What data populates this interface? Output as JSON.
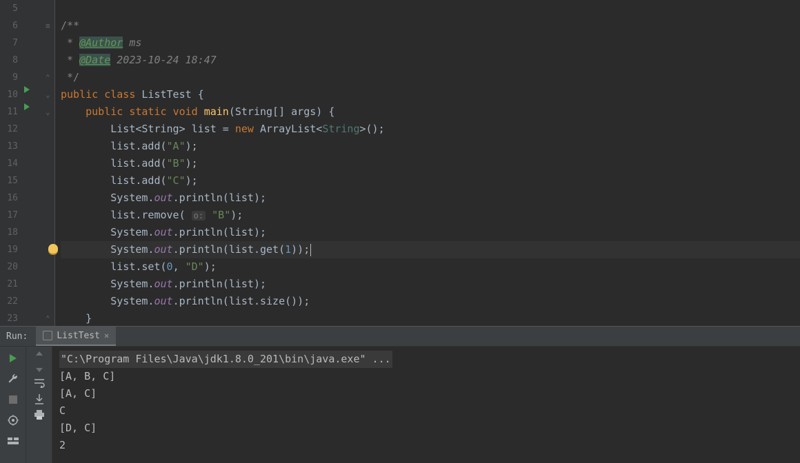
{
  "editor": {
    "lines": [
      {
        "n": 5,
        "tokens": []
      },
      {
        "n": 6,
        "tokens": [
          {
            "t": "/**",
            "cls": "comment"
          }
        ]
      },
      {
        "n": 7,
        "tokens": [
          {
            "t": " * ",
            "cls": "comment"
          },
          {
            "t": "@Author",
            "cls": "doc-tag"
          },
          {
            "t": " ms",
            "cls": "comment italic"
          }
        ]
      },
      {
        "n": 8,
        "tokens": [
          {
            "t": " * ",
            "cls": "comment"
          },
          {
            "t": "@Date",
            "cls": "doc-tag"
          },
          {
            "t": " 2023-10-24 18:47",
            "cls": "comment italic"
          }
        ]
      },
      {
        "n": 9,
        "tokens": [
          {
            "t": " */",
            "cls": "comment"
          }
        ]
      },
      {
        "n": 10,
        "run": true,
        "tokens": [
          {
            "t": "public ",
            "cls": "kw"
          },
          {
            "t": "class ",
            "cls": "kw"
          },
          {
            "t": "ListTest ",
            "cls": ""
          },
          {
            "t": "{",
            "cls": ""
          }
        ]
      },
      {
        "n": 11,
        "run": true,
        "tokens": [
          {
            "t": "    ",
            "cls": ""
          },
          {
            "t": "public ",
            "cls": "kw"
          },
          {
            "t": "static ",
            "cls": "kw"
          },
          {
            "t": "void ",
            "cls": "kw"
          },
          {
            "t": "main",
            "cls": "fn"
          },
          {
            "t": "(String[] args) {",
            "cls": ""
          }
        ]
      },
      {
        "n": 12,
        "tokens": [
          {
            "t": "        List<String> list = ",
            "cls": ""
          },
          {
            "t": "new ",
            "cls": "kw"
          },
          {
            "t": "ArrayList<",
            "cls": ""
          },
          {
            "t": "String",
            "cls": "generic-dim"
          },
          {
            "t": ">();",
            "cls": ""
          }
        ]
      },
      {
        "n": 13,
        "tokens": [
          {
            "t": "        list.add(",
            "cls": ""
          },
          {
            "t": "\"A\"",
            "cls": "str"
          },
          {
            "t": ");",
            "cls": ""
          }
        ]
      },
      {
        "n": 14,
        "tokens": [
          {
            "t": "        list.add(",
            "cls": ""
          },
          {
            "t": "\"B\"",
            "cls": "str"
          },
          {
            "t": ");",
            "cls": ""
          }
        ]
      },
      {
        "n": 15,
        "tokens": [
          {
            "t": "        list.add(",
            "cls": ""
          },
          {
            "t": "\"C\"",
            "cls": "str"
          },
          {
            "t": ");",
            "cls": ""
          }
        ]
      },
      {
        "n": 16,
        "tokens": [
          {
            "t": "        System.",
            "cls": ""
          },
          {
            "t": "out",
            "cls": "static-f"
          },
          {
            "t": ".println(list);",
            "cls": ""
          }
        ]
      },
      {
        "n": 17,
        "tokens": [
          {
            "t": "        list.remove( ",
            "cls": ""
          },
          {
            "t": "o:",
            "cls": "param-hint"
          },
          {
            "t": " ",
            "cls": ""
          },
          {
            "t": "\"B\"",
            "cls": "str"
          },
          {
            "t": ");",
            "cls": ""
          }
        ]
      },
      {
        "n": 18,
        "tokens": [
          {
            "t": "        System.",
            "cls": ""
          },
          {
            "t": "out",
            "cls": "static-f"
          },
          {
            "t": ".println(list);",
            "cls": ""
          }
        ]
      },
      {
        "n": 19,
        "bulb": true,
        "hl": true,
        "tokens": [
          {
            "t": "        System.",
            "cls": ""
          },
          {
            "t": "out",
            "cls": "static-f"
          },
          {
            "t": ".println(list.get(",
            "cls": ""
          },
          {
            "t": "1",
            "cls": "num"
          },
          {
            "t": "));",
            "cls": ""
          }
        ],
        "caret": true
      },
      {
        "n": 20,
        "tokens": [
          {
            "t": "        list.set(",
            "cls": ""
          },
          {
            "t": "0",
            "cls": "num"
          },
          {
            "t": ", ",
            "cls": ""
          },
          {
            "t": "\"D\"",
            "cls": "str"
          },
          {
            "t": ");",
            "cls": ""
          }
        ]
      },
      {
        "n": 21,
        "tokens": [
          {
            "t": "        System.",
            "cls": ""
          },
          {
            "t": "out",
            "cls": "static-f"
          },
          {
            "t": ".println(list);",
            "cls": ""
          }
        ]
      },
      {
        "n": 22,
        "tokens": [
          {
            "t": "        System.",
            "cls": ""
          },
          {
            "t": "out",
            "cls": "static-f"
          },
          {
            "t": ".println(list.size());",
            "cls": ""
          }
        ]
      },
      {
        "n": 23,
        "tokens": [
          {
            "t": "    }",
            "cls": ""
          }
        ]
      }
    ]
  },
  "run": {
    "label": "Run:",
    "tab": "ListTest",
    "console": [
      {
        "t": "\"C:\\Program Files\\Java\\jdk1.8.0_201\\bin\\java.exe\" ...",
        "cmd": true
      },
      {
        "t": "[A, B, C]"
      },
      {
        "t": "[A, C]"
      },
      {
        "t": "C"
      },
      {
        "t": "[D, C]"
      },
      {
        "t": "2"
      }
    ]
  }
}
